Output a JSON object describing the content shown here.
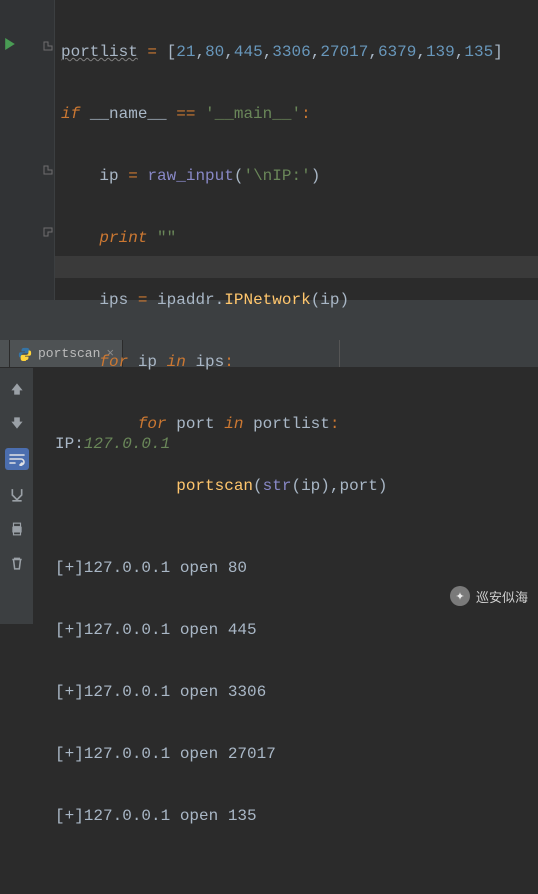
{
  "code": {
    "portlist_name": "portlist",
    "ports": [
      "21",
      "80",
      "445",
      "3306",
      "27017",
      "6379",
      "139",
      "135"
    ],
    "if_kw": "if",
    "name_dunder": "__name__",
    "eq": "==",
    "main_str": "'__main__'",
    "ip_var": "ip",
    "raw_input": "raw_input",
    "raw_input_arg": "'\\nIP:'",
    "print_kw": "print",
    "print_arg": "\"\"",
    "ips_var": "ips",
    "ipaddr_mod": "ipaddr",
    "ipnetwork_fn": "IPNetwork",
    "for_kw": "for",
    "in_kw": "in",
    "port_var": "port",
    "portscan_fn": "portscan",
    "str_fn": "str"
  },
  "tabs": {
    "active": "portscan"
  },
  "console": {
    "prompt_label": "IP:",
    "prompt_value": "127.0.0.1",
    "lines": [
      "[+]127.0.0.1 open 80",
      "[+]127.0.0.1 open 445",
      "[+]127.0.0.1 open 3306",
      "[+]127.0.0.1 open 27017",
      "[+]127.0.0.1 open 135"
    ]
  },
  "toolbar_icons": [
    "arrow-up",
    "arrow-down",
    "soft-wrap",
    "scroll-to-end",
    "print",
    "trash"
  ],
  "watermark": "巡安似海"
}
